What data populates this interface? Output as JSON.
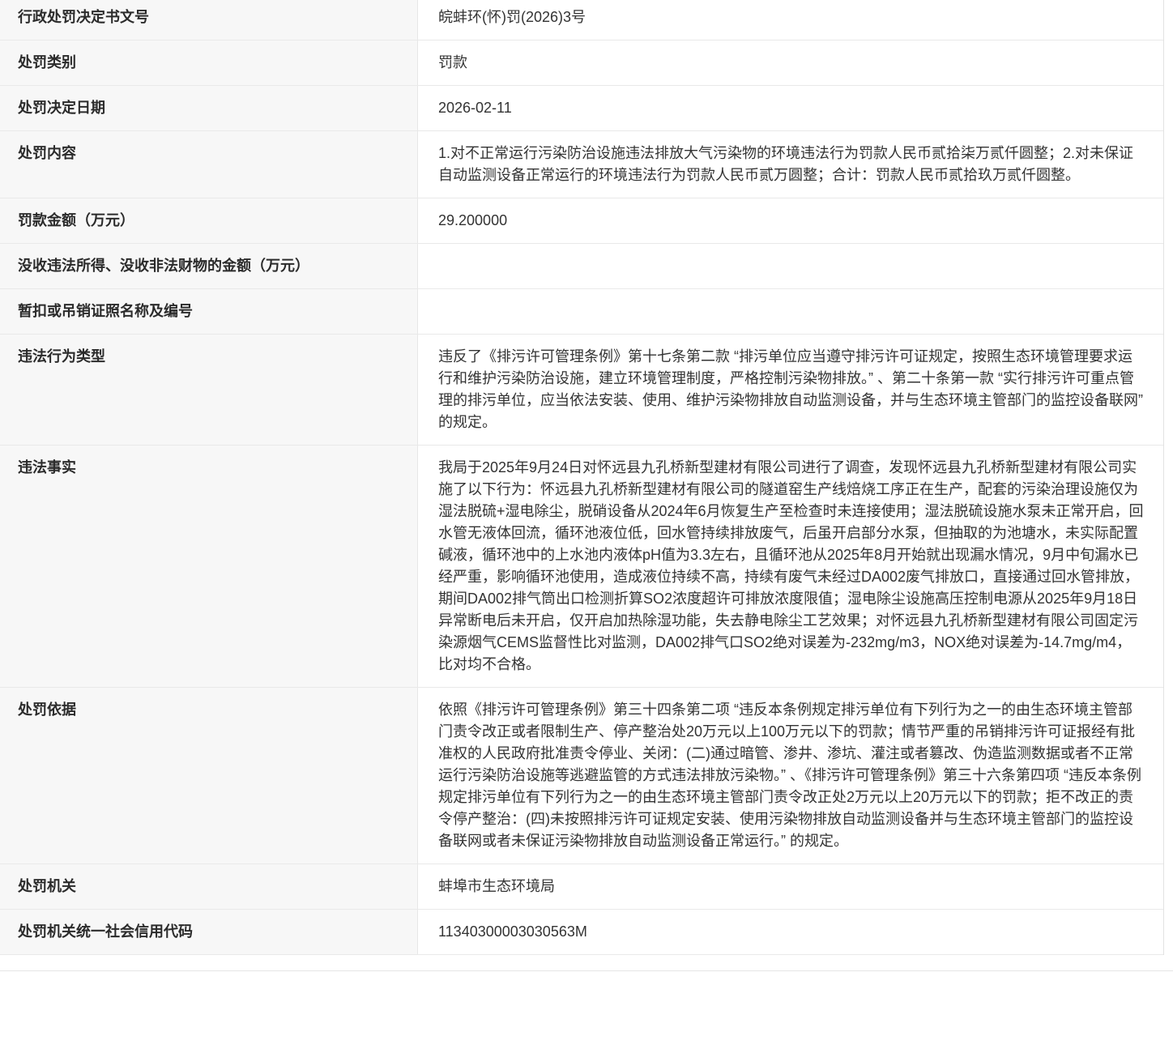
{
  "table": {
    "rows": [
      {
        "label": "行政处罚决定书文号",
        "value": "皖蚌环(怀)罚(2026)3号"
      },
      {
        "label": "处罚类别",
        "value": "罚款"
      },
      {
        "label": "处罚决定日期",
        "value": "2026-02-11"
      },
      {
        "label": "处罚内容",
        "value": "1.对不正常运行污染防治设施违法排放大气污染物的环境违法行为罚款人民币贰拾柒万贰仟圆整；2.对未保证自动监测设备正常运行的环境违法行为罚款人民币贰万圆整；合计：罚款人民币贰拾玖万贰仟圆整。"
      },
      {
        "label": "罚款金额（万元）",
        "value": "29.200000"
      },
      {
        "label": "没收违法所得、没收非法财物的金额（万元）",
        "value": ""
      },
      {
        "label": "暂扣或吊销证照名称及编号",
        "value": ""
      },
      {
        "label": "违法行为类型",
        "value": "违反了《排污许可管理条例》第十七条第二款 “排污单位应当遵守排污许可证规定，按照生态环境管理要求运行和维护污染防治设施，建立环境管理制度，严格控制污染物排放。” 、第二十条第一款 “实行排污许可重点管理的排污单位，应当依法安装、使用、维护污染物排放自动监测设备，并与生态环境主管部门的监控设备联网” 的规定。"
      },
      {
        "label": "违法事实",
        "value": "我局于2025年9月24日对怀远县九孔桥新型建材有限公司进行了调查，发现怀远县九孔桥新型建材有限公司实施了以下行为：怀远县九孔桥新型建材有限公司的隧道窑生产线焙烧工序正在生产，配套的污染治理设施仅为湿法脱硫+湿电除尘，脱硝设备从2024年6月恢复生产至检查时未连接使用；湿法脱硫设施水泵未正常开启，回水管无液体回流，循环池液位低，回水管持续排放废气，后虽开启部分水泵，但抽取的为池塘水，未实际配置碱液，循环池中的上水池内液体pH值为3.3左右，且循环池从2025年8月开始就出现漏水情况，9月中旬漏水已经严重，影响循环池使用，造成液位持续不高，持续有废气未经过DA002废气排放口，直接通过回水管排放，期间DA002排气筒出口检测折算SO2浓度超许可排放浓度限值；湿电除尘设施高压控制电源从2025年9月18日异常断电后未开启，仅开启加热除湿功能，失去静电除尘工艺效果；对怀远县九孔桥新型建材有限公司固定污染源烟气CEMS监督性比对监测，DA002排气口SO2绝对误差为-232mg/m3，NOX绝对误差为-14.7mg/m4，比对均不合格。"
      },
      {
        "label": "处罚依据",
        "value": "依照《排污许可管理条例》第三十四条第二项 “违反本条例规定排污单位有下列行为之一的由生态环境主管部门责令改正或者限制生产、停产整治处20万元以上100万元以下的罚款；情节严重的吊销排污许可证报经有批准权的人民政府批准责令停业、关闭：(二)通过暗管、渗井、渗坑、灌注或者篡改、伪造监测数据或者不正常运行污染防治设施等逃避监管的方式违法排放污染物。” 、《排污许可管理条例》第三十六条第四项 “违反本条例规定排污单位有下列行为之一的由生态环境主管部门责令改正处2万元以上20万元以下的罚款；拒不改正的责令停产整治：(四)未按照排污许可证规定安装、使用污染物排放自动监测设备并与生态环境主管部门的监控设备联网或者未保证污染物排放自动监测设备正常运行。” 的规定。"
      },
      {
        "label": "处罚机关",
        "value": "蚌埠市生态环境局"
      },
      {
        "label": "处罚机关统一社会信用代码",
        "value": "11340300003030563M"
      }
    ]
  },
  "colors": {
    "label_background": "#f7f7f7",
    "divider": "#e9e9e9",
    "text": "#333333"
  }
}
